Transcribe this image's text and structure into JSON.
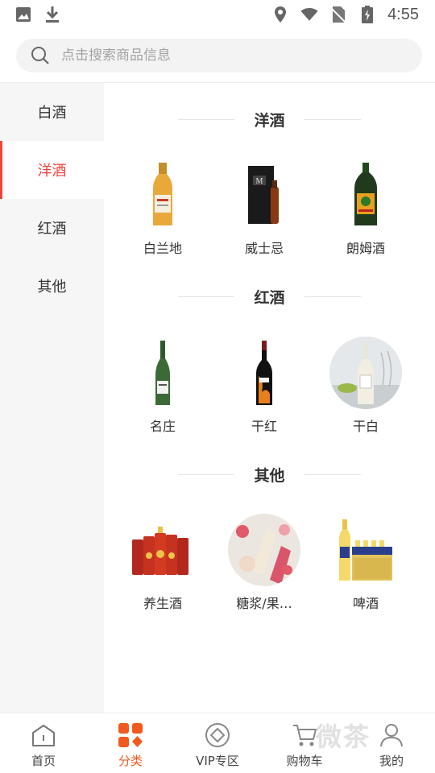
{
  "status_bar": {
    "time": "4:55"
  },
  "search": {
    "placeholder": "点击搜索商品信息"
  },
  "sidebar": {
    "items": [
      {
        "label": "白酒"
      },
      {
        "label": "洋酒"
      },
      {
        "label": "红酒"
      },
      {
        "label": "其他"
      }
    ],
    "active_index": 1
  },
  "sections": [
    {
      "title": "洋酒",
      "items": [
        {
          "label": "白兰地"
        },
        {
          "label": "威士忌"
        },
        {
          "label": "朗姆酒"
        }
      ]
    },
    {
      "title": "红酒",
      "items": [
        {
          "label": "名庄"
        },
        {
          "label": "干红"
        },
        {
          "label": "干白"
        }
      ]
    },
    {
      "title": "其他",
      "items": [
        {
          "label": "养生酒"
        },
        {
          "label": "糖浆/果…"
        },
        {
          "label": "啤酒"
        }
      ]
    }
  ],
  "bottom_nav": {
    "items": [
      {
        "label": "首页",
        "icon": "home-icon"
      },
      {
        "label": "分类",
        "icon": "category-icon"
      },
      {
        "label": "VIP专区",
        "icon": "vip-icon"
      },
      {
        "label": "购物车",
        "icon": "cart-icon"
      },
      {
        "label": "我的",
        "icon": "profile-icon"
      }
    ],
    "active_index": 1
  },
  "watermark": {
    "text": "微茶"
  },
  "colors": {
    "accent": "#f0433a",
    "nav_active": "#f05a1e"
  }
}
